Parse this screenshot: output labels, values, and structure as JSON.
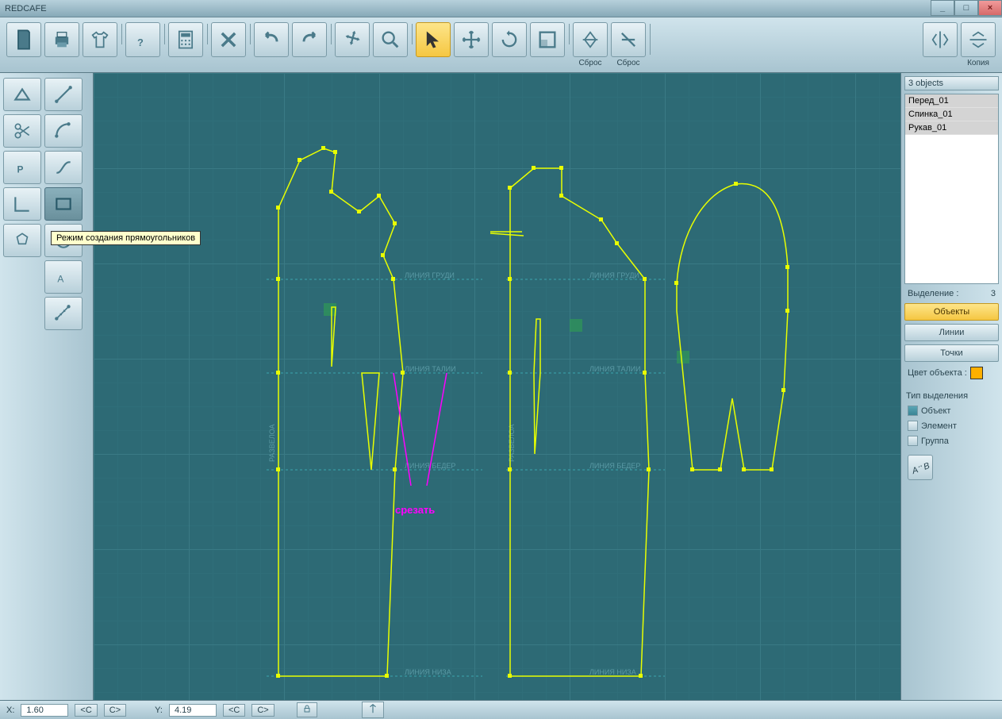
{
  "app_title": "REDCAFE",
  "toolbar": {
    "reset1_label": "Сброс",
    "reset2_label": "Сброс",
    "copy_label": "Копия"
  },
  "tooltip_text": "Режим создания прямоугольников",
  "right": {
    "objects_header": "3 objects",
    "objects": [
      {
        "name": "Перед_01"
      },
      {
        "name": "Спинка_01"
      },
      {
        "name": "Рукав_01"
      }
    ],
    "selection_label": "Выделение :",
    "selection_count": "3",
    "btn_objects": "Объекты",
    "btn_lines": "Линии",
    "btn_points": "Точки",
    "color_label": "Цвет объекта :",
    "color_value": "#ffb000",
    "seltype_label": "Тип выделения",
    "chk_object": "Объект",
    "chk_element": "Элемент",
    "chk_group": "Группа",
    "ab_label": "A←B"
  },
  "status": {
    "x_label": "X:",
    "x_value": "1.60",
    "y_label": "Y:",
    "y_value": "4.19",
    "lt": "<C",
    "gt": "C>"
  },
  "canvas_labels": {
    "chest1": "ЛИНИЯ  ГРУДИ",
    "chest2": "ЛИНИЯ  ГРУДИ",
    "waist1": "ЛИНИЯ  ТАЛИИ",
    "waist2": "ЛИНИЯ  ТАЛИИ",
    "hip1": "ЛИНИЯ  БЕДЕР",
    "hip2": "ЛИНИЯ  БЕДЕР",
    "hem1": "ЛИНИЯ  НИЗА",
    "hem2": "ЛИНИЯ  НИЗА",
    "fold1": "РАЗВЕЛОА",
    "fold2": "РАЗВЕЛОА",
    "cut": "срезать"
  }
}
